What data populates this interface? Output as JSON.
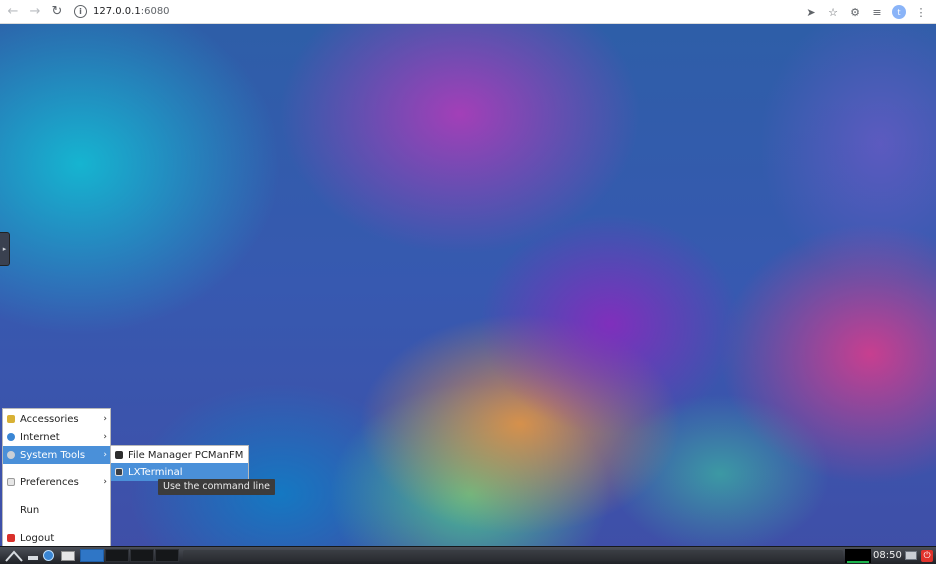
{
  "browser": {
    "url_host": "127.0.0.1",
    "url_port": ":6080",
    "profile_initial": "t"
  },
  "menu": {
    "items": [
      {
        "label": "Accessories",
        "icon": "accessories-icon",
        "has_submenu": true
      },
      {
        "label": "Internet",
        "icon": "internet-icon",
        "has_submenu": true
      },
      {
        "label": "System Tools",
        "icon": "system-tools-icon",
        "has_submenu": true,
        "active": true
      },
      {
        "label": "Preferences",
        "icon": "preferences-icon",
        "has_submenu": true
      },
      {
        "label": "Run",
        "icon": "",
        "has_submenu": false
      },
      {
        "label": "Logout",
        "icon": "logout-icon",
        "has_submenu": false
      }
    ],
    "arrow": "›"
  },
  "submenu": {
    "items": [
      {
        "label": "File Manager PCManFM",
        "icon": "file-manager-icon"
      },
      {
        "label": "LXTerminal",
        "icon": "terminal-icon",
        "active": true
      }
    ]
  },
  "tooltip": "Use the command line",
  "taskbar": {
    "clock": "08:50"
  },
  "colors": {
    "menu_highlight": "#4a90d9",
    "logout_red": "#d9302b",
    "power_red": "#e0322b"
  }
}
